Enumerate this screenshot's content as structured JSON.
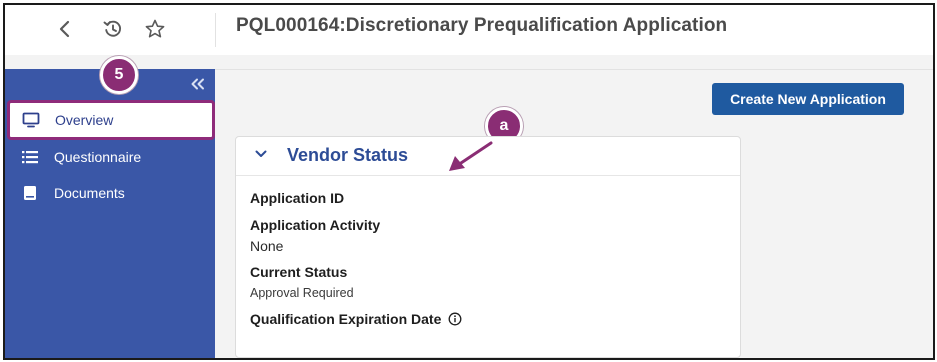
{
  "header": {
    "title": "PQL000164:Discretionary Prequalification Application",
    "icons": [
      "chevron-left-icon",
      "history-icon",
      "star-icon"
    ]
  },
  "sidebar": {
    "items": [
      {
        "label": "Overview",
        "icon": "monitor-icon",
        "active": true
      },
      {
        "label": "Questionnaire",
        "icon": "list-icon",
        "active": false
      },
      {
        "label": "Documents",
        "icon": "book-icon",
        "active": false
      }
    ]
  },
  "callouts": {
    "step": "5",
    "sub": "a"
  },
  "main": {
    "create_button_label": "Create New Application",
    "card": {
      "title": "Vendor Status",
      "fields": [
        {
          "label": "Application ID",
          "value": ""
        },
        {
          "label": "Application Activity",
          "value": "None"
        },
        {
          "label": "Current Status",
          "value": "Approval Required"
        },
        {
          "label": "Qualification Expiration Date",
          "value": ""
        }
      ]
    }
  },
  "colors": {
    "sidebar_bg": "#3a57a7",
    "highlight": "#8e2b7a",
    "primary_button": "#1f5aa0",
    "card_title": "#2d4c96"
  }
}
